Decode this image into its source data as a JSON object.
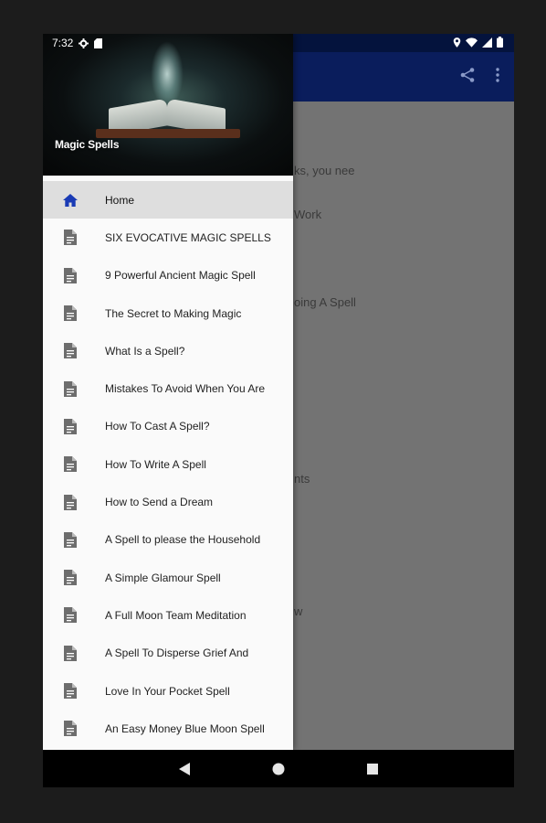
{
  "status_bar": {
    "time": "7:32"
  },
  "drawer": {
    "header_title": "Magic Spells",
    "items": [
      {
        "label": "Home",
        "icon": "home-icon",
        "active": true
      },
      {
        "label": "SIX EVOCATIVE MAGIC SPELLS",
        "icon": "document-icon"
      },
      {
        "label": "9 Powerful Ancient Magic Spell",
        "icon": "document-icon"
      },
      {
        "label": "The Secret to Making Magic",
        "icon": "document-icon"
      },
      {
        "label": "What Is a Spell?",
        "icon": "document-icon"
      },
      {
        "label": "Mistakes To Avoid When You Are",
        "icon": "document-icon"
      },
      {
        "label": "How To Cast A Spell?",
        "icon": "document-icon"
      },
      {
        "label": "How To Write A Spell",
        "icon": "document-icon"
      },
      {
        "label": "How to Send a Dream",
        "icon": "document-icon"
      },
      {
        "label": "A Spell to please the Household",
        "icon": "document-icon"
      },
      {
        "label": "A Simple Glamour Spell",
        "icon": "document-icon"
      },
      {
        "label": "A Full Moon Team Meditation",
        "icon": "document-icon"
      },
      {
        "label": "A Spell To Disperse Grief And",
        "icon": "document-icon"
      },
      {
        "label": "Love In Your Pocket Spell",
        "icon": "document-icon"
      },
      {
        "label": "An Easy Money Blue Moon Spell",
        "icon": "document-icon"
      }
    ]
  },
  "background_fragments": [
    "ks, you nee",
    "Work",
    "oing A Spell",
    "nts",
    "w"
  ],
  "colors": {
    "accent": "#1a3bb5",
    "app_bar": "#0a1d5c",
    "status_bar": "#04133d",
    "scrim": "#737373"
  }
}
